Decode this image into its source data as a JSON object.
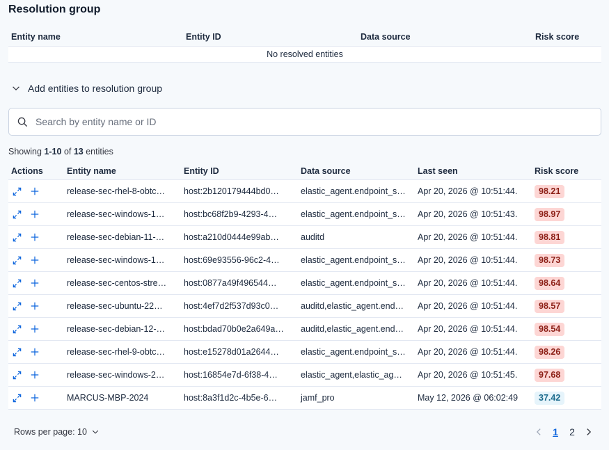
{
  "resolution": {
    "title": "Resolution group",
    "columns": [
      "Entity name",
      "Entity ID",
      "Data source",
      "Risk score"
    ],
    "empty_message": "No resolved entities"
  },
  "accordion": {
    "label": "Add entities to resolution group",
    "icon": "chevron-down-icon"
  },
  "search": {
    "placeholder": "Search by entity name or ID",
    "value": "",
    "icon": "search-icon"
  },
  "showing": {
    "prefix": "Showing ",
    "range": "1-10",
    "of": " of ",
    "total": "13",
    "suffix": " entities"
  },
  "entities": {
    "columns": [
      "Actions",
      "Entity name",
      "Entity ID",
      "Data source",
      "Last seen",
      "Risk score"
    ],
    "rows": [
      {
        "name": "release-sec-rhel-8-obtc…",
        "id": "host:2b120179444bd0…",
        "source": "elastic_agent.endpoint_s…",
        "last_seen": "Apr 20, 2026 @ 10:51:44.",
        "risk": "98.21",
        "level": "critical"
      },
      {
        "name": "release-sec-windows-1…",
        "id": "host:bc68f2b9-4293-4…",
        "source": "elastic_agent.endpoint_s…",
        "last_seen": "Apr 20, 2026 @ 10:51:43.",
        "risk": "98.97",
        "level": "critical"
      },
      {
        "name": "release-sec-debian-11-…",
        "id": "host:a210d0444e99ab…",
        "source": "auditd",
        "last_seen": "Apr 20, 2026 @ 10:51:44.",
        "risk": "98.81",
        "level": "critical"
      },
      {
        "name": "release-sec-windows-1…",
        "id": "host:69e93556-96c2-4…",
        "source": "elastic_agent.endpoint_s…",
        "last_seen": "Apr 20, 2026 @ 10:51:44.",
        "risk": "98.73",
        "level": "critical"
      },
      {
        "name": "release-sec-centos-stre…",
        "id": "host:0877a49f496544…",
        "source": "elastic_agent.endpoint_s…",
        "last_seen": "Apr 20, 2026 @ 10:51:44.",
        "risk": "98.64",
        "level": "critical"
      },
      {
        "name": "release-sec-ubuntu-22…",
        "id": "host:4ef7d2f537d93c0…",
        "source": "auditd,elastic_agent.end…",
        "last_seen": "Apr 20, 2026 @ 10:51:44.",
        "risk": "98.57",
        "level": "critical"
      },
      {
        "name": "release-sec-debian-12-…",
        "id": "host:bdad70b0e2a649a…",
        "source": "auditd,elastic_agent.end…",
        "last_seen": "Apr 20, 2026 @ 10:51:44.",
        "risk": "98.54",
        "level": "critical"
      },
      {
        "name": "release-sec-rhel-9-obtc…",
        "id": "host:e15278d01a2644…",
        "source": "elastic_agent.endpoint_s…",
        "last_seen": "Apr 20, 2026 @ 10:51:44.",
        "risk": "98.26",
        "level": "critical"
      },
      {
        "name": "release-sec-windows-2…",
        "id": "host:16854e7d-6f38-4…",
        "source": "elastic_agent,elastic_ag…",
        "last_seen": "Apr 20, 2026 @ 10:51:45.",
        "risk": "97.68",
        "level": "critical"
      },
      {
        "name": "MARCUS-MBP-2024",
        "id": "host:8a3f1d2c-4b5e-6…",
        "source": "jamf_pro",
        "last_seen": "May 12, 2026 @ 06:02:49",
        "risk": "37.42",
        "level": "low"
      }
    ]
  },
  "footer": {
    "rows_per_page": "Rows per page: 10",
    "pages": [
      "1",
      "2"
    ],
    "current_page": "1"
  },
  "colors": {
    "critical_bg": "#fdd6d4",
    "critical_text": "#8c1f16",
    "low_bg": "#e6f4fb",
    "low_text": "#1b6a8c",
    "link": "#0b64dd",
    "icon": "#0b64dd"
  }
}
